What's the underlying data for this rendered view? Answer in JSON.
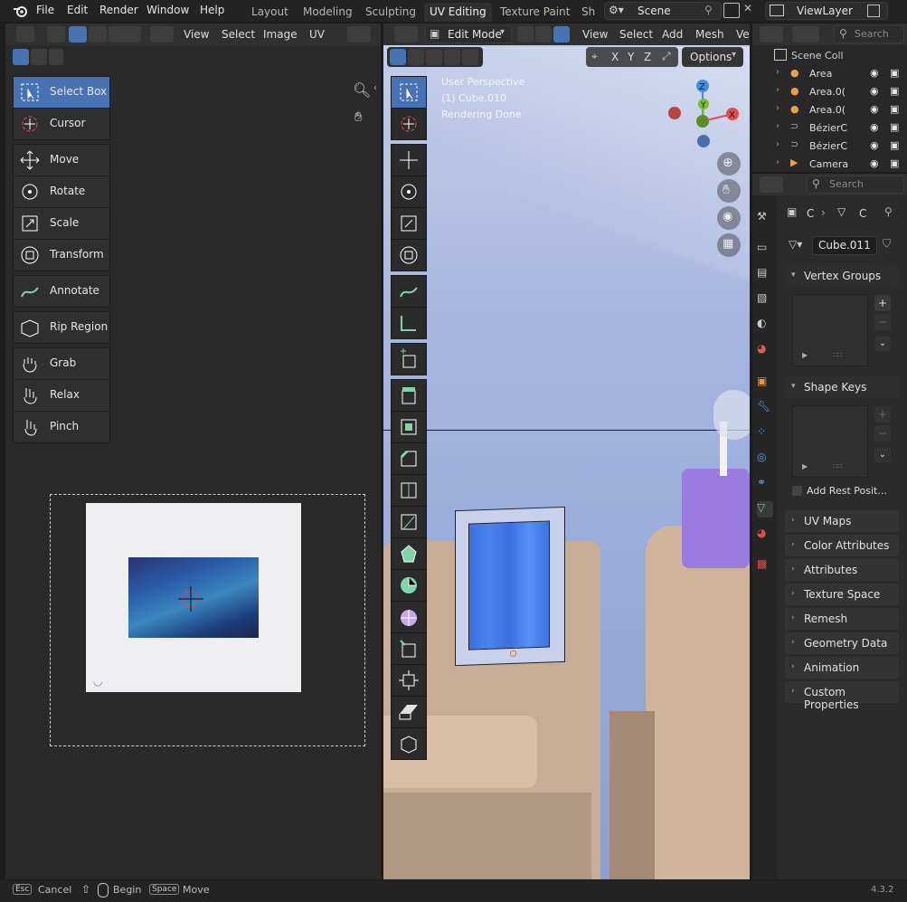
{
  "menu": {
    "file": "File",
    "edit": "Edit",
    "render": "Render",
    "window": "Window",
    "help": "Help"
  },
  "workspaces": [
    "Layout",
    "Modeling",
    "Sculpting",
    "UV Editing",
    "Texture Paint",
    "Sh"
  ],
  "scene": {
    "name": "Scene"
  },
  "viewlayer": {
    "name": "ViewLayer"
  },
  "uv_editor": {
    "menus": {
      "view": "View",
      "select": "Select",
      "image": "Image",
      "uv": "UV"
    },
    "tools": [
      "Select Box",
      "Cursor",
      "Move",
      "Rotate",
      "Scale",
      "Transform",
      "Annotate",
      "Rip Region",
      "Grab",
      "Relax",
      "Pinch"
    ]
  },
  "viewport": {
    "mode": "Edit Mode",
    "menus": {
      "view": "View",
      "select": "Select",
      "add": "Add",
      "mesh": "Mesh",
      "more": "Ve"
    },
    "axes": {
      "x": "X",
      "y": "Y",
      "z": "Z"
    },
    "options": "Options",
    "info": {
      "line1": "User Perspective",
      "line2": "(1) Cube.010",
      "line3": "Rendering Done"
    },
    "gizmo": {
      "x": "X",
      "y": "Y",
      "z": "Z"
    }
  },
  "outliner": {
    "search": "Search",
    "collection": "Scene Coll",
    "items": [
      "Area",
      "Area.0(",
      "Area.0(",
      "BézierC",
      "BézierC",
      "Camera"
    ]
  },
  "properties": {
    "search": "Search",
    "breadcrumb": {
      "a": "C",
      "b": "C"
    },
    "mesh_name": "Cube.011",
    "vertex_groups": "Vertex Groups",
    "shape_keys": "Shape Keys",
    "add_rest": "Add Rest Posit...",
    "sections": [
      "UV Maps",
      "Color Attributes",
      "Attributes",
      "Texture Space",
      "Remesh",
      "Geometry Data",
      "Animation",
      "Custom Properties"
    ]
  },
  "status": {
    "esc": "Esc",
    "cancel": "Cancel",
    "begin": "Begin",
    "space": "Space",
    "move": "Move",
    "version": "4.3.2"
  },
  "colors": {
    "accent": "#4772b3",
    "panel": "#2b2b2b",
    "header": "#303030"
  }
}
